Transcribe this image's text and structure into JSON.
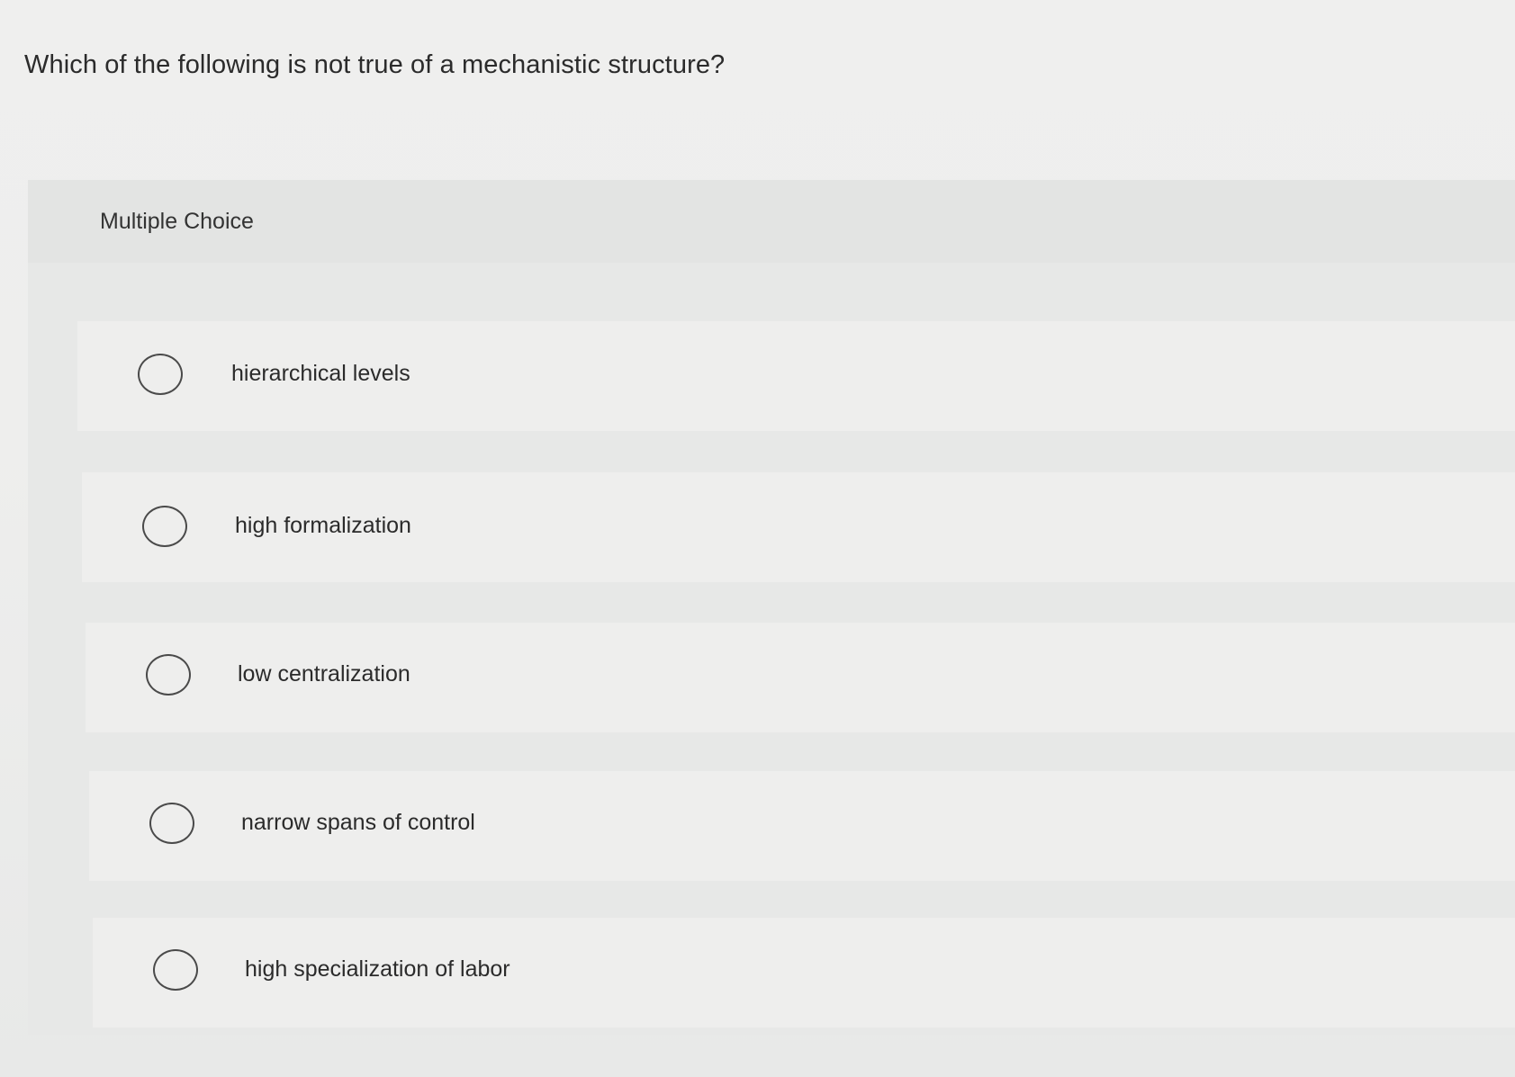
{
  "question": {
    "text": "Which of the following is not true of a mechanistic structure?"
  },
  "multiple_choice": {
    "label": "Multiple Choice",
    "options": [
      {
        "label": "hierarchical levels",
        "selected": false
      },
      {
        "label": "high formalization",
        "selected": false
      },
      {
        "label": "low centralization",
        "selected": false
      },
      {
        "label": "narrow spans of control",
        "selected": false
      },
      {
        "label": "high specialization of labor",
        "selected": false
      }
    ]
  }
}
